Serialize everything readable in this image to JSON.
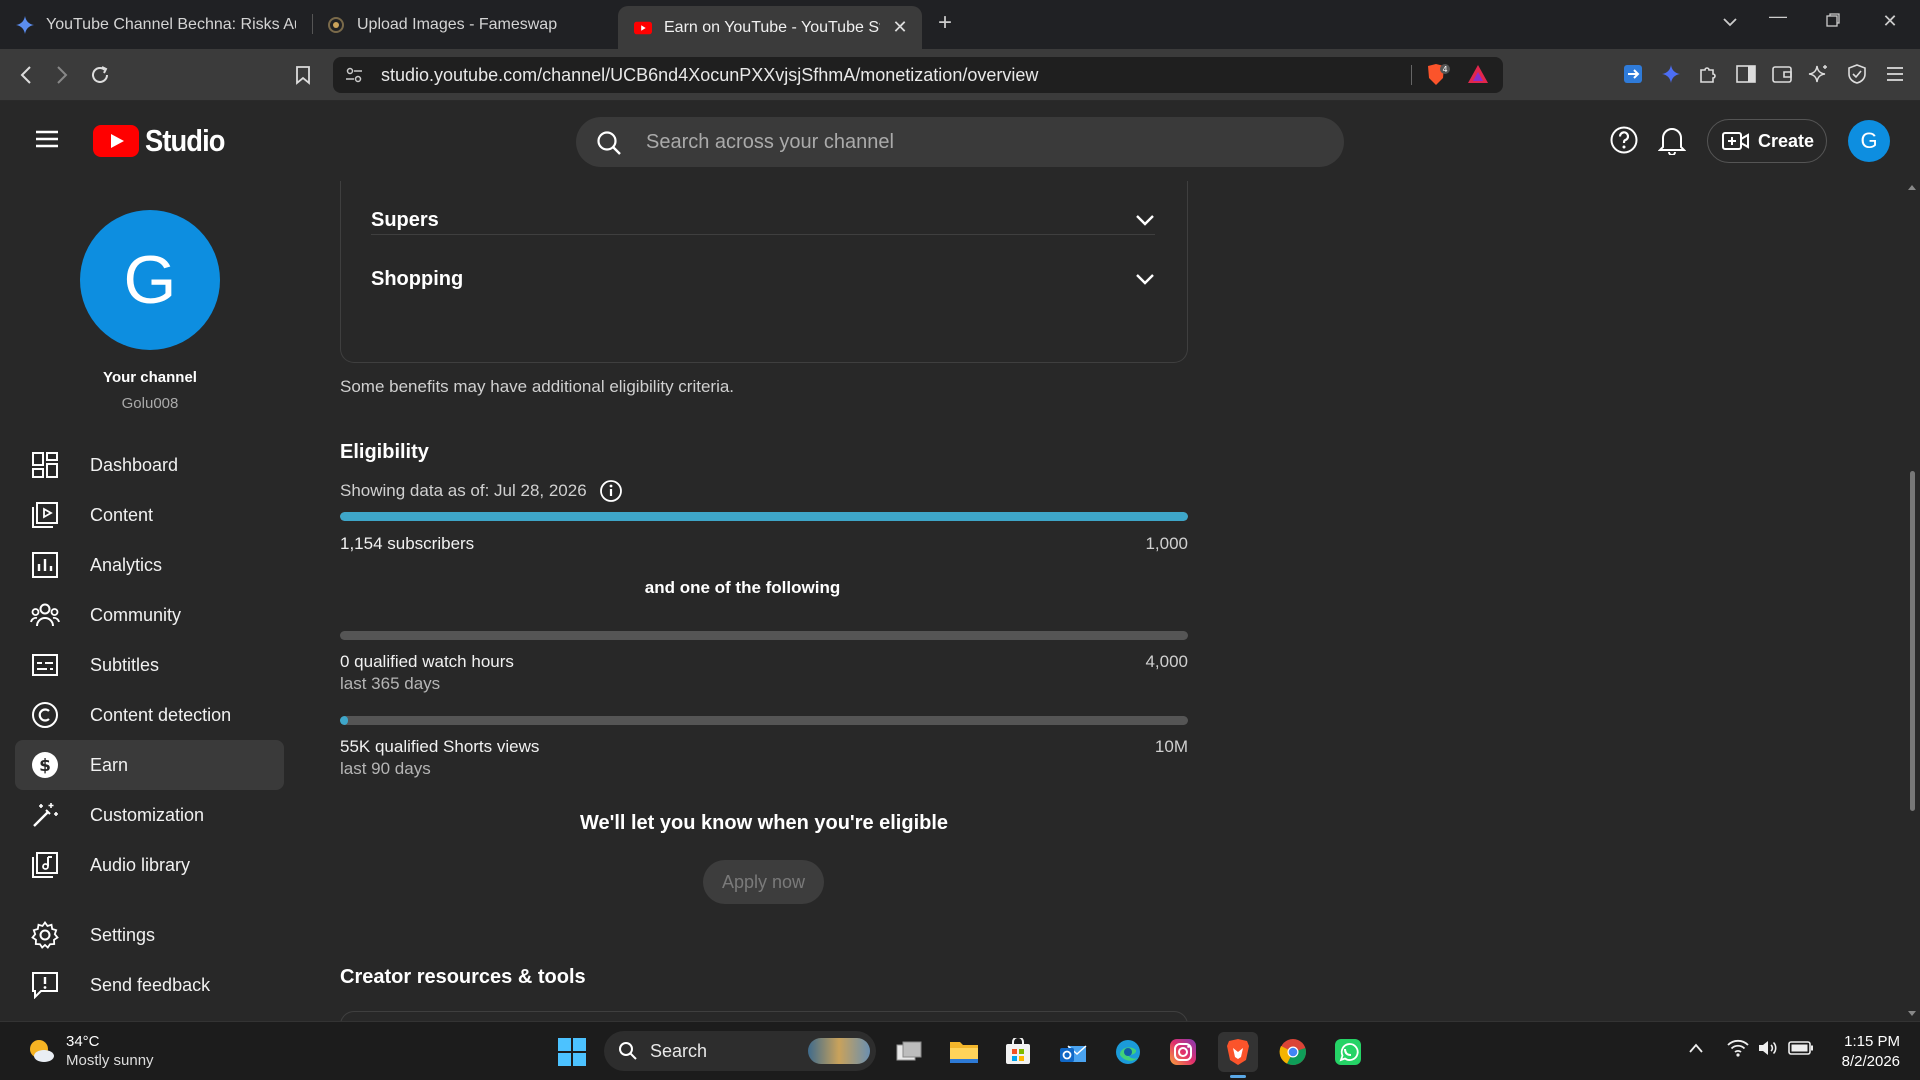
{
  "browser": {
    "tabs": [
      {
        "title": "YouTube Channel Bechna: Risks Aur N"
      },
      {
        "title": "Upload Images - Fameswap"
      },
      {
        "title": "Earn on YouTube - YouTube Studi"
      }
    ],
    "url": "studio.youtube.com/channel/UCB6nd4XocunPXXvjsjSfhmA/monetization/overview",
    "shield_count": "4"
  },
  "header": {
    "logo_text": "Studio",
    "search_placeholder": "Search across your channel",
    "create_label": "Create",
    "avatar_letter": "G"
  },
  "sidebar": {
    "avatar_letter": "G",
    "channel_title": "Your channel",
    "channel_handle": "Golu008",
    "items": [
      {
        "label": "Dashboard",
        "icon": "dashboard-icon"
      },
      {
        "label": "Content",
        "icon": "content-icon"
      },
      {
        "label": "Analytics",
        "icon": "analytics-icon"
      },
      {
        "label": "Community",
        "icon": "community-icon"
      },
      {
        "label": "Subtitles",
        "icon": "subtitles-icon"
      },
      {
        "label": "Content detection",
        "icon": "copyright-icon"
      },
      {
        "label": "Earn",
        "icon": "dollar-icon",
        "active": true
      },
      {
        "label": "Customization",
        "icon": "magic-wand-icon"
      },
      {
        "label": "Audio library",
        "icon": "audio-library-icon"
      },
      {
        "label": "Settings",
        "icon": "gear-icon"
      },
      {
        "label": "Send feedback",
        "icon": "feedback-icon"
      }
    ]
  },
  "main": {
    "accordions": [
      {
        "label": "Supers"
      },
      {
        "label": "Shopping"
      }
    ],
    "note": "Some benefits may have additional eligibility criteria.",
    "eligibility": {
      "title": "Eligibility",
      "date_text": "Showing data as of: Jul 28, 2026",
      "subscribers": {
        "label": "1,154 subscribers",
        "target": "1,000",
        "progress": 1.0
      },
      "or_text": "and one of the following",
      "watch_hours": {
        "label": "0 qualified watch hours",
        "sub": "last 365 days",
        "target": "4,000",
        "progress": 0.0
      },
      "shorts_views": {
        "label": "55K qualified Shorts views",
        "sub": "last 90 days",
        "target": "10M",
        "progress": 0.0055
      },
      "let_know": "We'll let you know when you're eligible",
      "apply_label": "Apply now"
    },
    "resources_title": "Creator resources & tools"
  },
  "taskbar": {
    "weather_temp": "34°C",
    "weather_desc": "Mostly sunny",
    "search_label": "Search",
    "time": "1:15 PM",
    "date": "8/2/2026"
  },
  "colors": {
    "youtube_red": "#ff0000",
    "accent_blue": "#3ea6c9",
    "avatar_blue": "#0d8ee0"
  }
}
